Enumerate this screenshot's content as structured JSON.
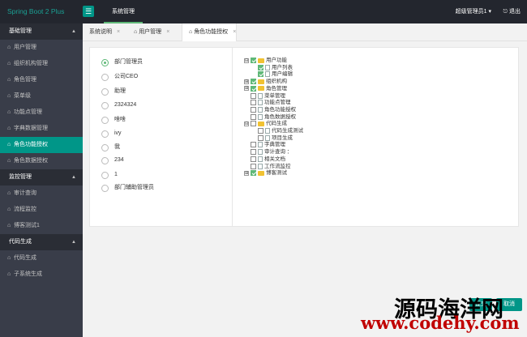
{
  "header": {
    "logo": "Spring Boot 2 Plus",
    "menu_icon": "list-icon",
    "top_nav": "系统管理",
    "user": "超级管理员1 ▾",
    "logout_icon": "logout-icon",
    "logout": "退出"
  },
  "sidebar": {
    "groups": [
      {
        "title": "基础管理",
        "items": [
          "用户管理",
          "组织机构管理",
          "角色管理",
          "菜单级",
          "功能点管理",
          "字典数据管理",
          "角色功能授权",
          "角色数据授权"
        ]
      },
      {
        "title": "监控管理",
        "items": [
          "审计查询",
          "流程监控",
          "博客测试1"
        ]
      },
      {
        "title": "代码生成",
        "items": [
          "代码生成",
          "子系统生成"
        ]
      }
    ],
    "active_item": "角色功能授权"
  },
  "tabs": [
    {
      "label": "系统说明",
      "close": "×"
    },
    {
      "label": "用户管理",
      "close": "×"
    },
    {
      "label": "角色功能授权",
      "close": "×"
    }
  ],
  "roles": {
    "selected": "部门管理员",
    "items": [
      "部门管理员",
      "公司CEO",
      "助理",
      "2324324",
      "啥啥",
      "ivy",
      "我",
      "234",
      "1",
      "部门辅助管理员"
    ]
  },
  "tree": [
    {
      "label": "用户功能",
      "toggle": "⊟",
      "checked": true,
      "type": "folder",
      "level": 0
    },
    {
      "label": "用户列表",
      "toggle": "",
      "checked": true,
      "type": "page",
      "level": 1
    },
    {
      "label": "用户编辑",
      "toggle": "",
      "checked": true,
      "type": "page",
      "level": 1
    },
    {
      "label": "组织机构",
      "toggle": "⊞",
      "checked": true,
      "type": "folder",
      "level": 0
    },
    {
      "label": "角色管理",
      "toggle": "⊞",
      "checked": true,
      "type": "folder",
      "level": 0
    },
    {
      "label": "菜单管理",
      "toggle": "",
      "checked": false,
      "type": "page",
      "level": 0
    },
    {
      "label": "功能点管理",
      "toggle": "",
      "checked": false,
      "type": "page",
      "level": 0
    },
    {
      "label": "角色功能授权",
      "toggle": "",
      "checked": false,
      "type": "page",
      "level": 0
    },
    {
      "label": "角色数据授权",
      "toggle": "",
      "checked": false,
      "type": "page",
      "level": 0
    },
    {
      "label": "代码生成",
      "toggle": "⊟",
      "checked": false,
      "type": "folder",
      "level": 0
    },
    {
      "label": "代码生成测试",
      "toggle": "",
      "checked": false,
      "type": "page",
      "level": 1
    },
    {
      "label": "项目生成",
      "toggle": "",
      "checked": false,
      "type": "page",
      "level": 1
    },
    {
      "label": "字典管理",
      "toggle": "",
      "checked": false,
      "type": "page",
      "level": 0
    },
    {
      "label": "审计查询  ：",
      "toggle": "",
      "checked": false,
      "type": "page",
      "level": 0
    },
    {
      "label": "相关文档",
      "toggle": "",
      "checked": false,
      "type": "page",
      "level": 0
    },
    {
      "label": "工作流监控",
      "toggle": "",
      "checked": false,
      "type": "page",
      "level": 0
    },
    {
      "label": "博客测试",
      "toggle": "⊞",
      "checked": true,
      "type": "folder",
      "level": 0
    }
  ],
  "buttons": {
    "submit": "提交",
    "cancel": "取消"
  },
  "watermark": {
    "line1": "源码海洋网",
    "line2": "www.codehy.com"
  },
  "colors": {
    "accent": "#009688",
    "sidebar": "#393d49",
    "header": "#23262e",
    "check": "#5fb878"
  }
}
